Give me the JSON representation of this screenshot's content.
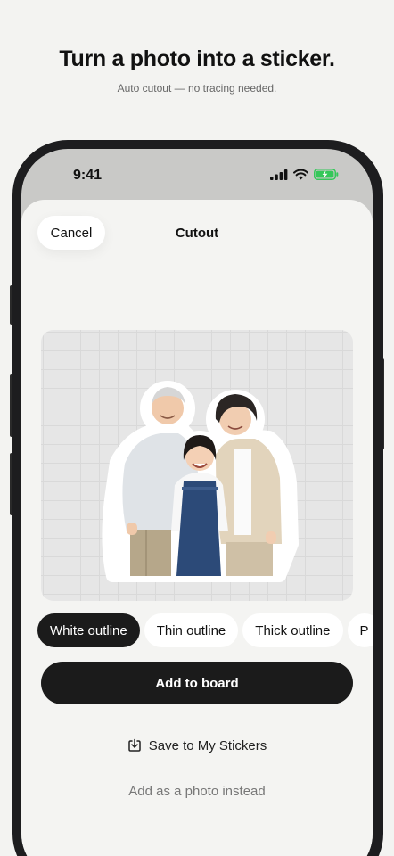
{
  "promo": {
    "headline": "Turn a photo into a sticker.",
    "subline": "Auto cutout — no tracing needed."
  },
  "status_bar": {
    "time": "9:41",
    "icons": [
      "cellular-signal-icon",
      "wifi-icon",
      "battery-charging-icon"
    ],
    "battery_color": "#34c759"
  },
  "sheet": {
    "cancel_label": "Cancel",
    "title": "Cutout"
  },
  "canvas": {
    "content": "sticker-cutout-image",
    "sticker_outline_color": "#ffffff"
  },
  "outline_options": {
    "selected": "White outline",
    "items": [
      "White outline",
      "Thin outline",
      "Thick outline",
      "P"
    ]
  },
  "actions": {
    "add_label": "Add to board",
    "save_label": "Save to My Stickers",
    "save_icon": "save-download-icon",
    "photo_label": "Add as a photo instead"
  },
  "colors": {
    "primary": "#1b1b1b",
    "background": "#f4f4f2",
    "muted_text": "#777777"
  }
}
